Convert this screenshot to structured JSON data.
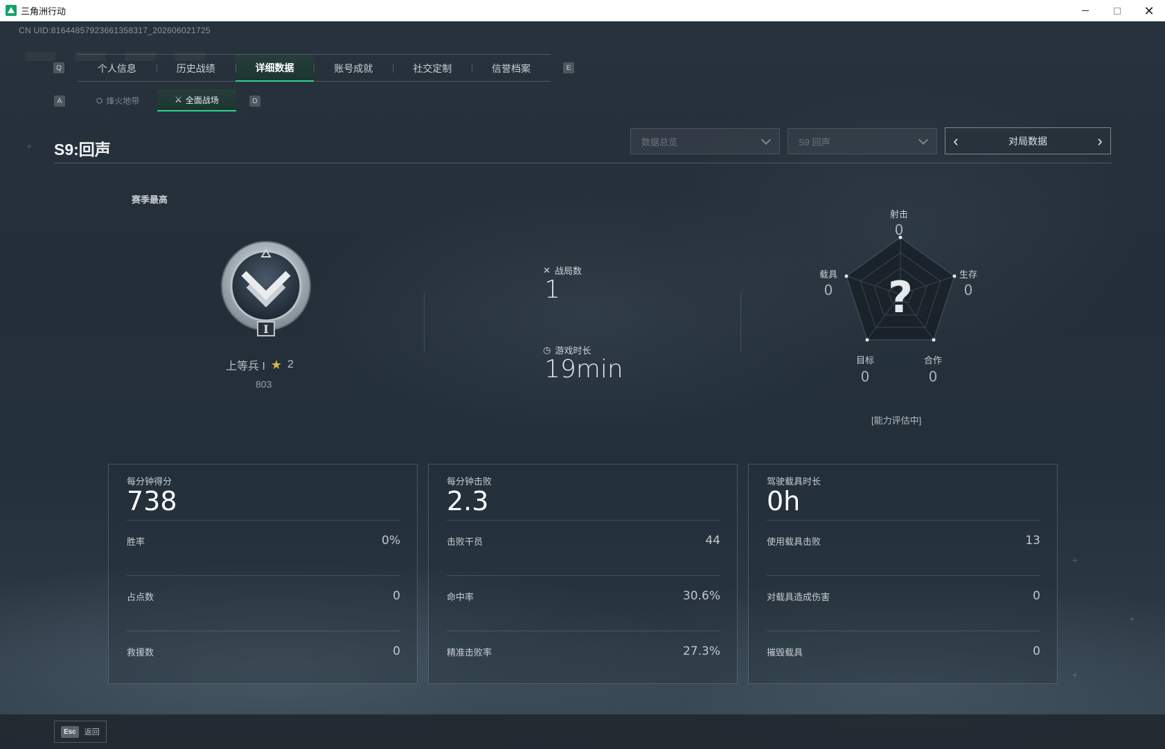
{
  "window": {
    "title": "三角洲行动"
  },
  "uid": "CN UID:81644857923661358317_202606021725",
  "tabs": {
    "key_left": "Q",
    "key_right": "E",
    "items": [
      "个人信息",
      "历史战绩",
      "详细数据",
      "账号成就",
      "社交定制",
      "信誉档案"
    ],
    "active_index": 2
  },
  "subtabs": {
    "key_left": "A",
    "key_right": "D",
    "items": [
      "烽火地带",
      "全面战场"
    ],
    "active_index": 1
  },
  "header": {
    "season_title": "S9:回声",
    "dropdown_view": "数据总览",
    "dropdown_season": "S9 回声",
    "pager_label": "对局数据"
  },
  "rank": {
    "section_label": "赛季最高",
    "title": "上等兵 I",
    "stars": "2",
    "points": "803",
    "badge_numeral": "I"
  },
  "summary": {
    "matches_label": "战局数",
    "matches_value": "1",
    "playtime_label": "游戏时长",
    "playtime_value": "19min"
  },
  "radar": {
    "center_symbol": "?",
    "axes": [
      {
        "label": "射击",
        "value": "0"
      },
      {
        "label": "生存",
        "value": "0"
      },
      {
        "label": "合作",
        "value": "0"
      },
      {
        "label": "目标",
        "value": "0"
      },
      {
        "label": "载具",
        "value": "0"
      }
    ],
    "status": "[能力评估中]"
  },
  "cards": [
    {
      "head_label": "每分钟得分",
      "head_value": "738",
      "rows": [
        {
          "label": "胜率",
          "value": "0%"
        },
        {
          "label": "占点数",
          "value": "0"
        },
        {
          "label": "救援数",
          "value": "0"
        }
      ]
    },
    {
      "head_label": "每分钟击败",
      "head_value": "2.3",
      "rows": [
        {
          "label": "击败干员",
          "value": "44"
        },
        {
          "label": "命中率",
          "value": "30.6%"
        },
        {
          "label": "精准击败率",
          "value": "27.3%"
        }
      ]
    },
    {
      "head_label": "驾驶载具时长",
      "head_value": "0h",
      "rows": [
        {
          "label": "使用载具击败",
          "value": "13"
        },
        {
          "label": "对载具造成伤害",
          "value": "0"
        },
        {
          "label": "摧毁载具",
          "value": "0"
        }
      ]
    }
  ],
  "footer": {
    "esc_key": "Esc",
    "back_label": "返回"
  },
  "colors": {
    "accent": "#2fd48f",
    "star": "#d9b84a",
    "background": "#242e38"
  }
}
